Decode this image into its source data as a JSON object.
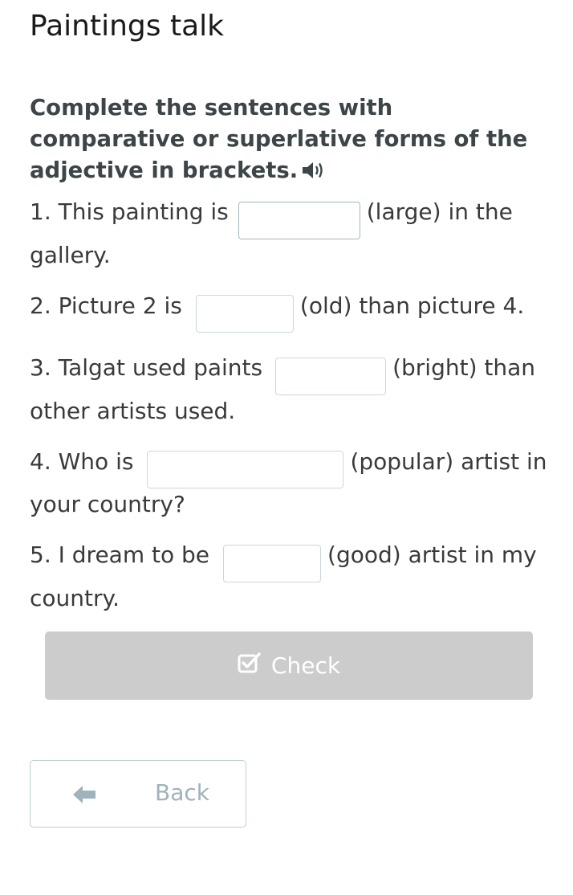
{
  "page": {
    "title": "Paintings talk"
  },
  "task": {
    "instructions": "Complete the sentences with comparative or superlative forms of the adjective in brackets.",
    "audio_icon": "speaker-icon"
  },
  "sentences": [
    {
      "before": "1. This painting is",
      "value": "",
      "after": "(large) in the gallery."
    },
    {
      "before": "2. Picture 2 is",
      "value": "",
      "after": "(old) than picture 4."
    },
    {
      "before": "3. Talgat used paints",
      "value": "",
      "after": "(bright) than other artists used."
    },
    {
      "before": "4. Who is",
      "value": "",
      "after": "(popular) artist in your country?"
    },
    {
      "before": "5. I dream to be",
      "value": "",
      "after": "(good) artist in my country."
    }
  ],
  "buttons": {
    "check_label": "Check",
    "check_icon": "checkbox-icon",
    "back_label": "Back",
    "back_icon": "arrow-left-icon"
  },
  "colors": {
    "check_button_bg": "#cccccc",
    "back_button_border": "#b8cfd5",
    "back_button_text": "#9fb3ba",
    "input_border": "#c9d8dc",
    "heading_text": "#3d4548"
  }
}
